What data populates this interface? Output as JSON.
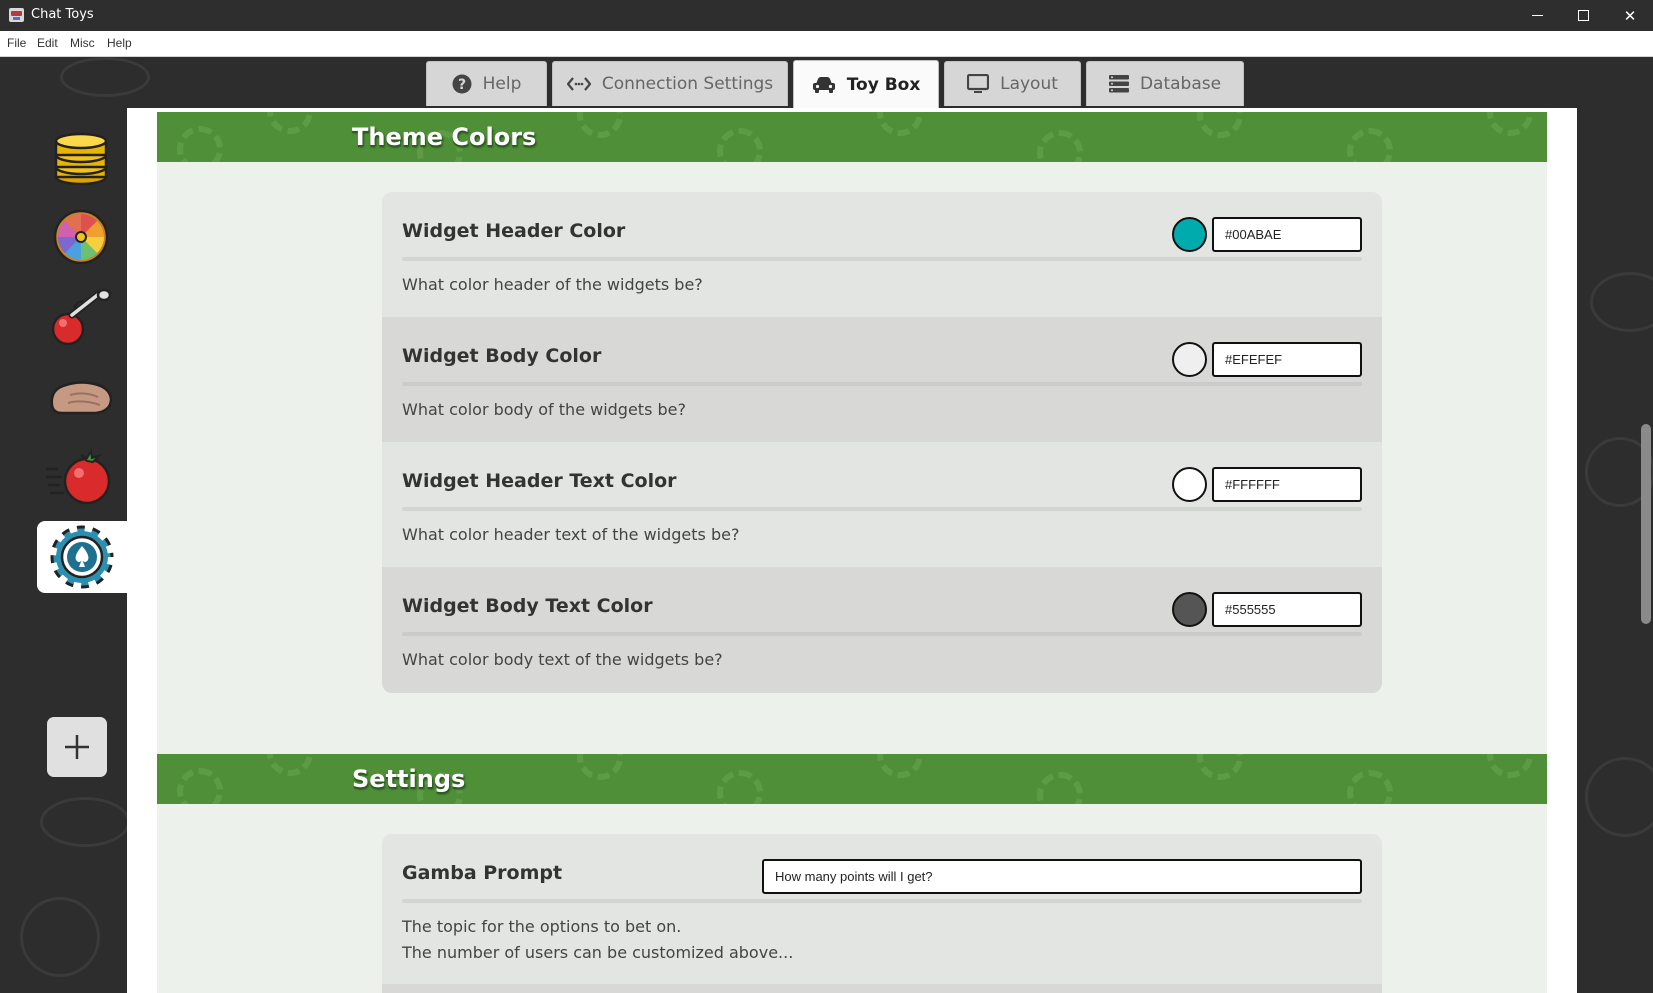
{
  "window": {
    "title": "Chat Toys"
  },
  "menu": [
    "File",
    "Edit",
    "Misc",
    "Help"
  ],
  "tabs": [
    {
      "label": "Help",
      "icon": "question-circle-icon"
    },
    {
      "label": "Connection Settings",
      "icon": "code-arrows-icon"
    },
    {
      "label": "Toy Box",
      "icon": "car-icon",
      "active": true
    },
    {
      "label": "Layout",
      "icon": "monitor-icon"
    },
    {
      "label": "Database",
      "icon": "database-icon"
    }
  ],
  "sidebar": {
    "toys": [
      {
        "name": "coin-stack-toy",
        "icon": "coin-stack-icon"
      },
      {
        "name": "prize-wheel-toy",
        "icon": "prize-wheel-icon"
      },
      {
        "name": "cherry-slingshot-toy",
        "icon": "cherry-icon"
      },
      {
        "name": "hand-slap-toy",
        "icon": "hand-icon"
      },
      {
        "name": "tomato-throw-toy",
        "icon": "tomato-icon"
      },
      {
        "name": "poker-chip-toy",
        "icon": "poker-chip-icon",
        "active": true
      }
    ],
    "add_icon": "plus-icon"
  },
  "theme_colors": {
    "title": "Theme Colors",
    "rows": [
      {
        "label": "Widget Header Color",
        "value": "#00ABAE",
        "swatch": "#00ABAE",
        "desc": "What color header of the widgets be?"
      },
      {
        "label": "Widget Body Color",
        "value": "#EFEFEF",
        "swatch": "#EFEFEF",
        "desc": "What color body of the widgets be?"
      },
      {
        "label": "Widget Header Text Color",
        "value": "#FFFFFF",
        "swatch": "#FFFFFF",
        "desc": "What color header text of the widgets be?"
      },
      {
        "label": "Widget Body Text Color",
        "value": "#555555",
        "swatch": "#555555",
        "desc": "What color body text of the widgets be?"
      }
    ]
  },
  "settings": {
    "title": "Settings",
    "gamba_prompt": {
      "label": "Gamba Prompt",
      "value": "How many points will I get?",
      "desc_line1": "The topic for the options to bet on.",
      "desc_line2": "The number of users can be customized above..."
    }
  },
  "colors": {
    "accent_green": "#4E8F37",
    "panel_bg": "#EDF1EC",
    "card_bg": "#E2E5E1",
    "card_alt_bg": "#D8D9D7"
  }
}
